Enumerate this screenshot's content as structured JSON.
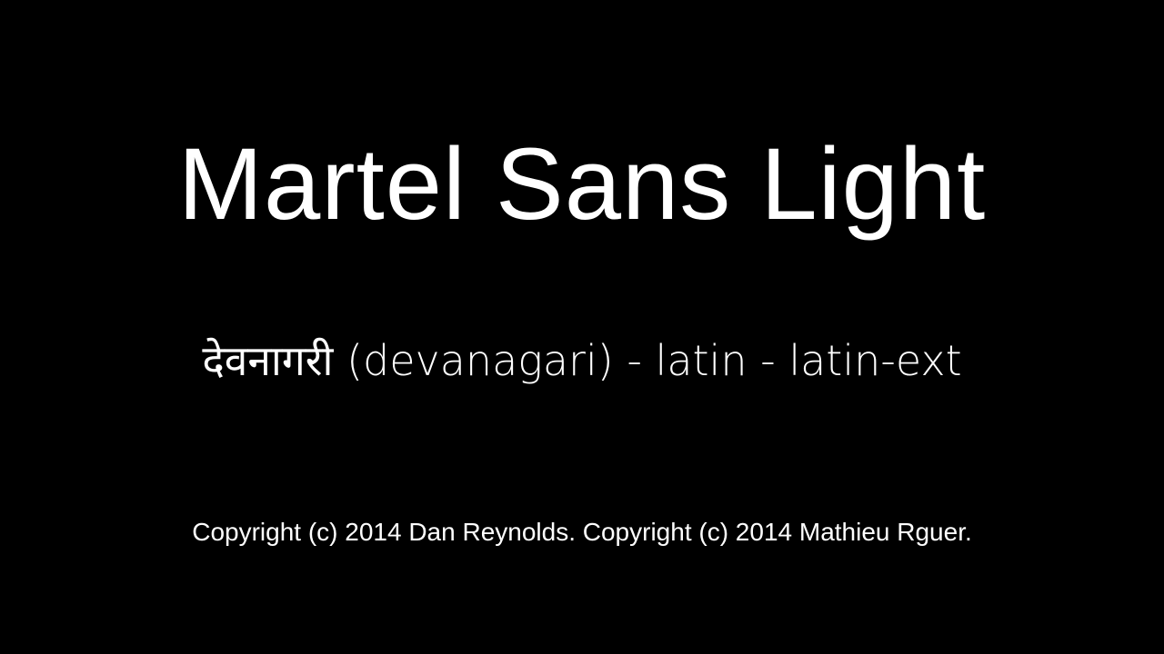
{
  "font_specimen": {
    "title": "Martel Sans Light",
    "scripts_line": "देवनागरी (devanagari) - latin - latin-ext",
    "copyright": "Copyright (c) 2014 Dan Reynolds. Copyright (c) 2014 Mathieu Rguer."
  },
  "colors": {
    "background": "#000000",
    "text": "#ffffff"
  }
}
